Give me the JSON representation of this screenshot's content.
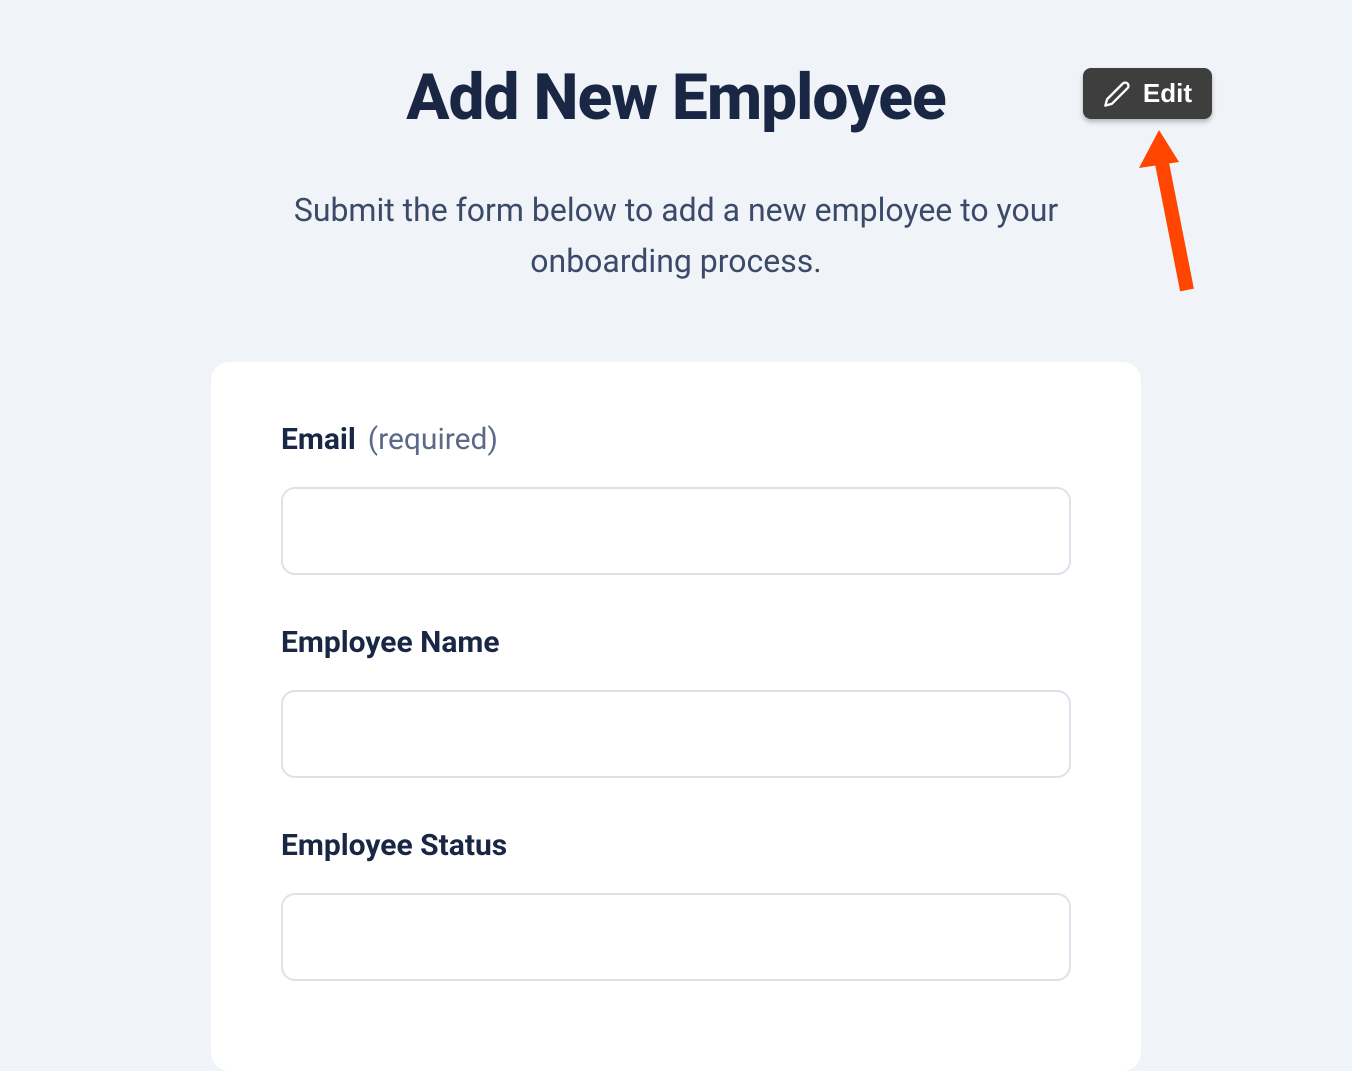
{
  "header": {
    "title": "Add New Employee",
    "subtitle": "Submit the form below to add a new employee to your onboarding process."
  },
  "editButton": {
    "label": "Edit"
  },
  "form": {
    "fields": [
      {
        "label": "Email",
        "required_text": "(required)",
        "required": true,
        "value": ""
      },
      {
        "label": "Employee Name",
        "required_text": "",
        "required": false,
        "value": ""
      },
      {
        "label": "Employee Status",
        "required_text": "",
        "required": false,
        "value": ""
      }
    ]
  }
}
